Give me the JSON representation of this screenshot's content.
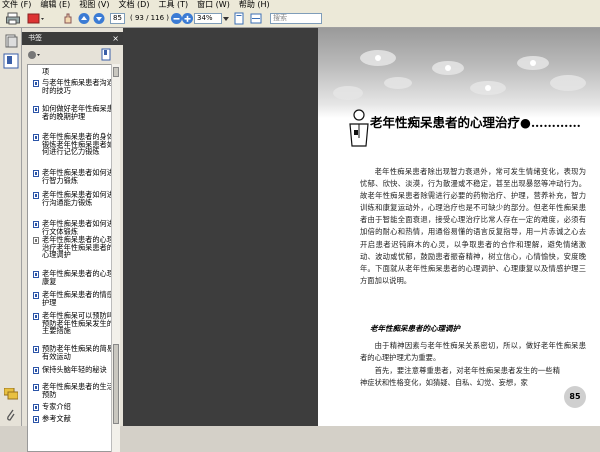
{
  "menu": [
    "文件 (F)",
    "编辑 (E)",
    "视图 (V)",
    "文档 (D)",
    "工具 (T)",
    "窗口 (W)",
    "帮助 (H)"
  ],
  "toolbar": {
    "page_current": "85",
    "page_total": "( 93 / 116 )",
    "zoom": "34%",
    "search_placeholder": "搜索"
  },
  "bookmarks": {
    "title": "书签",
    "items": [
      {
        "text": "项",
        "icon": "bookmark-icon"
      },
      {
        "text": "与老年性痴呆患者沟通时的技巧",
        "icon": "bookmark-icon"
      },
      {
        "text": "如何做好老年性痴呆患者的晚期护理",
        "icon": "bookmark-icon"
      },
      {
        "text": "老年性痴呆患者的身体锻炼老年性痴呆患者如何进行记忆力锻炼",
        "icon": "bookmark-icon"
      },
      {
        "text": "老年性痴呆患者如何进行智力锻炼",
        "icon": "bookmark-icon"
      },
      {
        "text": "老年性痴呆患者如何进行沟通能力锻炼",
        "icon": "bookmark-icon"
      },
      {
        "text": "老年性痴呆患者如何进行文体锻炼",
        "icon": "bookmark-icon"
      },
      {
        "text": "老年性痴呆患者的心理治疗老年性痴呆患者的心理调护",
        "icon": "bookmark-gray-icon"
      },
      {
        "text": "老年性痴呆患者的心理康复",
        "icon": "bookmark-icon"
      },
      {
        "text": "老年性痴呆患者的情感护理",
        "icon": "bookmark-icon"
      },
      {
        "text": "老年性痴呆可以预防吗预防老年性痴呆发生的主要措施",
        "icon": "bookmark-icon"
      },
      {
        "text": "预防老年性痴呆的简易有效运动",
        "icon": "bookmark-icon"
      },
      {
        "text": "保持头脑年轻的秘诀",
        "icon": "bookmark-icon"
      },
      {
        "text": "老年性痴呆患者的生活预防",
        "icon": "bookmark-icon"
      },
      {
        "text": "专家介绍",
        "icon": "bookmark-icon"
      },
      {
        "text": "参考文献",
        "icon": "bookmark-icon"
      }
    ]
  },
  "page": {
    "title": "老年性痴呆患者的心理治疗●…………",
    "paragraph1": "老年性痴呆患者除出现智力衰退外，常可发生情绪变化，表现为忧郁、欣快、淡漠，行为散漫或不稳定，甚至出现暴怒等冲动行为。故老年性痴呆患者除需进行必要的药物治疗、护理，营养补充，智力训练和康复运动外，心理治疗也是不可缺少的部分。但老年性痴呆患者由于智能全面衰退，接受心理治疗比常人存在一定的难度，必须有加倍的耐心和热情，用通俗易懂的语言反复指导，用一片赤诚之心去开启患者迟钝麻木的心灵，以争取患者的合作和理解，避免情绪激动、波动或忧郁，鼓励患者振奋精神，树立信心，心情愉快，安度晚年。下面就从老年性痴呆患者的心理调护、心理康复以及情感护理三方面加以说明。",
    "subheading": "老年性痴呆患者的心理调护",
    "paragraph2": "由于精神因素与老年性痴呆关系密切，所以，做好老年性痴呆患者的心理护理尤为重要。",
    "paragraph3": "首先，要注意尊重患者，对老年性痴呆患者发生的一些精神症状和性格变化，如猜疑、自私、幻觉、妄想，家",
    "page_number": "85"
  }
}
